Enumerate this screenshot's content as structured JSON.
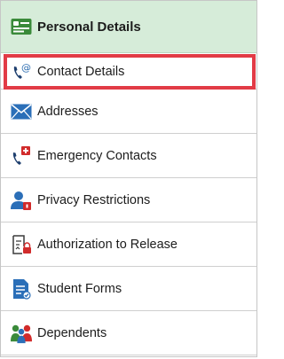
{
  "menu": {
    "header": {
      "label": "Personal Details",
      "icon": "id-card-icon"
    },
    "items": [
      {
        "label": "Contact Details",
        "icon": "phone-at-icon",
        "selected": true
      },
      {
        "label": "Addresses",
        "icon": "envelope-icon"
      },
      {
        "label": "Emergency Contacts",
        "icon": "phone-alert-icon"
      },
      {
        "label": "Privacy Restrictions",
        "icon": "user-lock-icon"
      },
      {
        "label": "Authorization to Release",
        "icon": "document-lock-icon"
      },
      {
        "label": "Student Forms",
        "icon": "form-document-icon"
      },
      {
        "label": "Dependents",
        "icon": "people-icon"
      }
    ]
  },
  "colors": {
    "header_bg": "#d6ecd9",
    "header_icon": "#3a8a3a",
    "selection_border": "#e23b46"
  }
}
